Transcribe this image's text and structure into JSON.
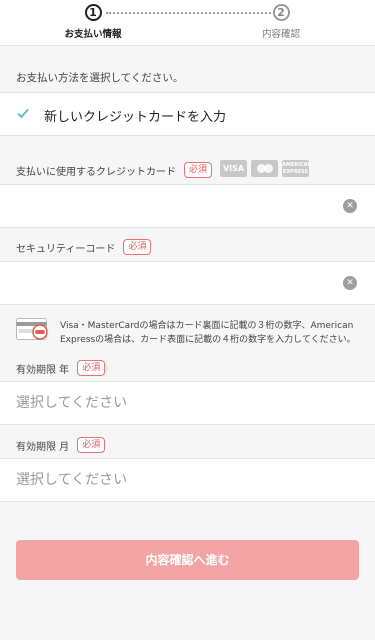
{
  "stepper": {
    "step1": {
      "number": "1",
      "label": "お支払い情報"
    },
    "step2": {
      "number": "2",
      "label": "内容確認"
    }
  },
  "payment": {
    "instruction": "お支払い方法を選択してください。",
    "selected_option": "新しいクレジットカードを入力",
    "card_number": {
      "label": "支払いに使用するクレジットカード",
      "required": "必須",
      "value": "",
      "clear_icon": "clear-circle-icon"
    },
    "brands": [
      {
        "name": "VISA"
      },
      {
        "name": "MasterCard"
      },
      {
        "name": "AMERICAN EXPRESS"
      }
    ],
    "security_code": {
      "label": "セキュリティーコード",
      "required": "必須",
      "value": ""
    },
    "cvc_help": "Visa・MasterCardの場合はカード裏面に記載の３桁の数字、American Expressの場合は、カード表面に記載の４桁の数字を入力してください。",
    "expiry_year": {
      "label": "有効期限 年",
      "required": "必須",
      "placeholder": "選択してください"
    },
    "expiry_month": {
      "label": "有効期限 月",
      "required": "必須",
      "placeholder": "選択してください"
    }
  },
  "submit_label": "内容確認へ進む",
  "colors": {
    "accent_check": "#4fc3b4",
    "required": "#e05a5a",
    "submit_bg": "#f3a5a5"
  }
}
